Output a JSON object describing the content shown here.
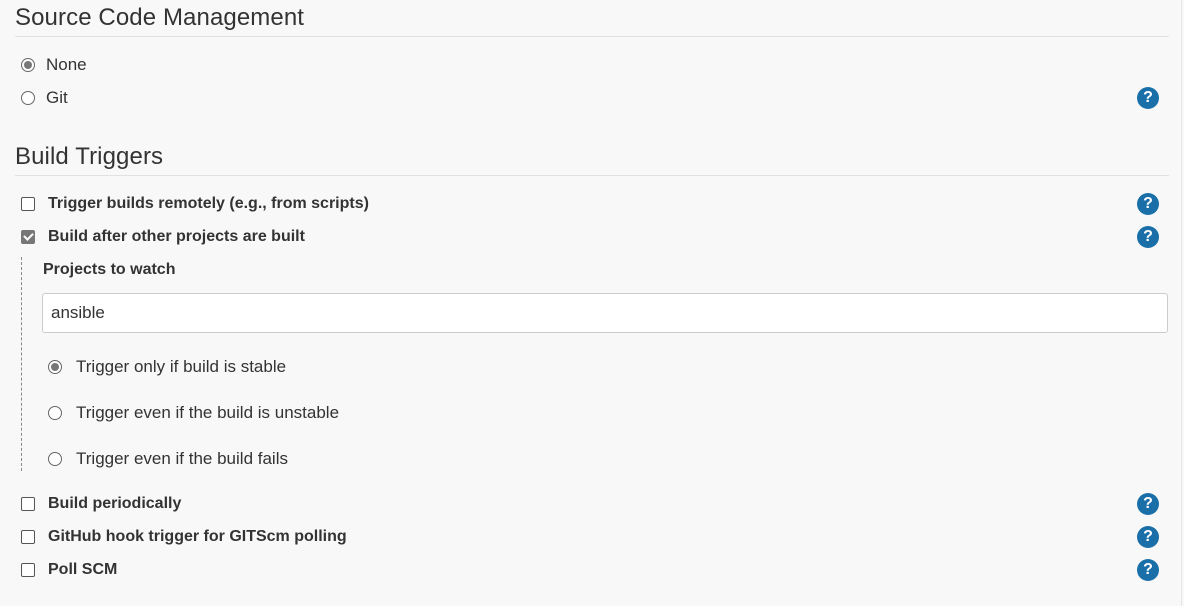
{
  "scm": {
    "title": "Source Code Management",
    "options": [
      {
        "label": "None",
        "checked": true
      },
      {
        "label": "Git",
        "checked": false
      }
    ]
  },
  "build_triggers": {
    "title": "Build Triggers",
    "remote": {
      "label": "Trigger builds remotely (e.g., from scripts)",
      "checked": false
    },
    "after_other": {
      "label": "Build after other projects are built",
      "checked": true
    },
    "projects_to_watch": {
      "label": "Projects to watch",
      "value": "ansible"
    },
    "trigger_options": [
      {
        "label": "Trigger only if build is stable",
        "checked": true
      },
      {
        "label": "Trigger even if the build is unstable",
        "checked": false
      },
      {
        "label": "Trigger even if the build fails",
        "checked": false
      }
    ],
    "periodic": {
      "label": "Build periodically",
      "checked": false
    },
    "github_hook": {
      "label": "GitHub hook trigger for GITScm polling",
      "checked": false
    },
    "poll_scm": {
      "label": "Poll SCM",
      "checked": false
    }
  },
  "help_icon_glyph": "?",
  "colors": {
    "help_icon": "#1a6fa8"
  }
}
